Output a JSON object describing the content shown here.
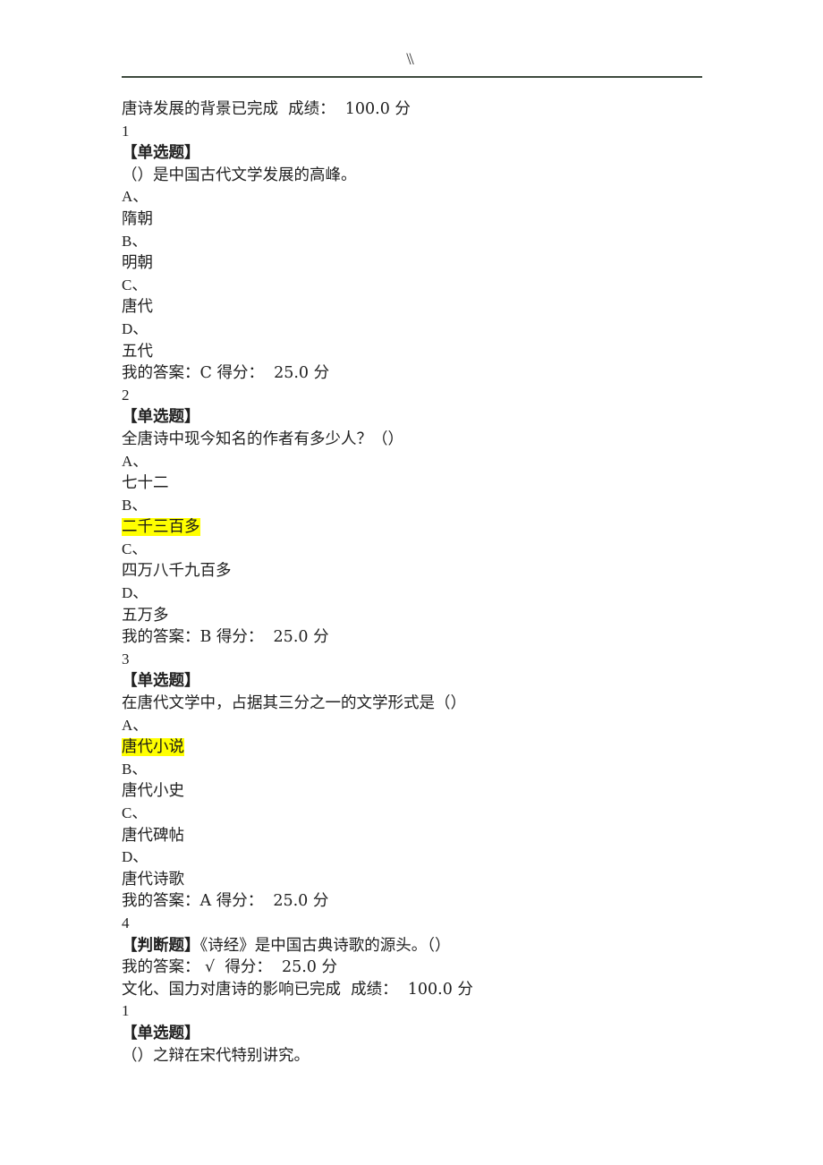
{
  "header": {
    "mark": "\\\\",
    "rule_color": "#3e4a3e"
  },
  "highlight_color": "#FFFF00",
  "labels": {
    "single_choice_tag": "【单选题】",
    "true_false_tag": "【判断题】",
    "my_answer_prefix": "我的答案：",
    "score_prefix": "得分：",
    "grade_prefix": "成绩：",
    "point_unit": "分",
    "completed": "已完成"
  },
  "sections": [
    {
      "heading": "唐诗发展的背景已完成  成绩：  100.0 分",
      "heading_title": "唐诗发展的背景",
      "heading_status": "已完成",
      "heading_grade": "100.0 分",
      "questions": [
        {
          "index": "1",
          "tag": "【单选题】",
          "stem": "（）是中国古代文学发展的高峰。",
          "options": [
            {
              "label": "A、",
              "text": "隋朝",
              "highlighted": false
            },
            {
              "label": "B、",
              "text": "明朝",
              "highlighted": false
            },
            {
              "label": "C、",
              "text": "唐代",
              "highlighted": false
            },
            {
              "label": "D、",
              "text": "五代",
              "highlighted": false
            }
          ],
          "my_answer": "C",
          "score": "25.0 分",
          "answer_line": "我的答案：C 得分：  25.0 分"
        },
        {
          "index": "2",
          "tag": "【单选题】",
          "stem": "全唐诗中现今知名的作者有多少人？（）",
          "options": [
            {
              "label": "A、",
              "text": "七十二",
              "highlighted": false
            },
            {
              "label": "B、",
              "text": "二千三百多",
              "highlighted": true
            },
            {
              "label": "C、",
              "text": "四万八千九百多",
              "highlighted": false
            },
            {
              "label": "D、",
              "text": "五万多",
              "highlighted": false
            }
          ],
          "my_answer": "B",
          "score": "25.0 分",
          "answer_line": "我的答案：B 得分：  25.0 分"
        },
        {
          "index": "3",
          "tag": "【单选题】",
          "stem": "在唐代文学中，占据其三分之一的文学形式是（）",
          "options": [
            {
              "label": "A、",
              "text": "唐代小说",
              "highlighted": true
            },
            {
              "label": "B、",
              "text": "唐代小史",
              "highlighted": false
            },
            {
              "label": "C、",
              "text": "唐代碑帖",
              "highlighted": false
            },
            {
              "label": "D、",
              "text": "唐代诗歌",
              "highlighted": false
            }
          ],
          "my_answer": "A",
          "score": "25.0 分",
          "answer_line": "我的答案：A 得分：  25.0 分"
        },
        {
          "index": "4",
          "tag": "【判断题】",
          "inline_stem": "《诗经》是中国古典诗歌的源头。（）",
          "options": [],
          "my_answer": "√",
          "score": "25.0 分",
          "answer_line": "我的答案： √  得分：  25.0 分"
        }
      ]
    },
    {
      "heading": "文化、国力对唐诗的影响已完成  成绩：  100.0 分",
      "heading_title": "文化、国力对唐诗的影响",
      "heading_status": "已完成",
      "heading_grade": "100.0 分",
      "questions": [
        {
          "index": "1",
          "tag": "【单选题】",
          "stem": "（）之辩在宋代特别讲究。",
          "options": [],
          "my_answer": "",
          "score": "",
          "answer_line": ""
        }
      ]
    }
  ]
}
